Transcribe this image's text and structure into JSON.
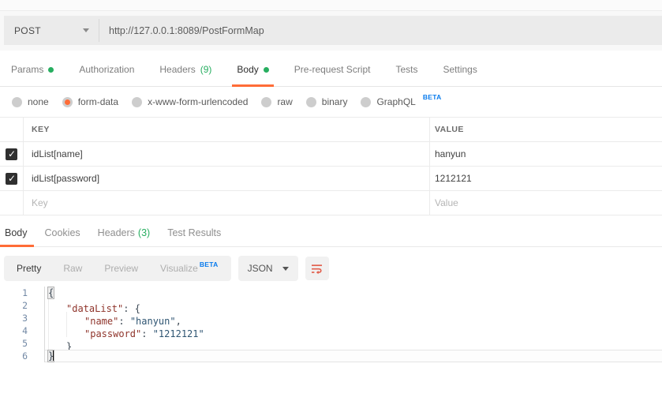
{
  "request": {
    "method": "POST",
    "url": "http://127.0.0.1:8089/PostFormMap",
    "tabs": [
      {
        "label": "Params",
        "has_dot": true,
        "active": false
      },
      {
        "label": "Authorization",
        "active": false
      },
      {
        "label": "Headers",
        "count": "(9)",
        "active": false
      },
      {
        "label": "Body",
        "has_dot": true,
        "active": true
      },
      {
        "label": "Pre-request Script",
        "active": false
      },
      {
        "label": "Tests",
        "active": false
      },
      {
        "label": "Settings",
        "active": false
      }
    ],
    "body_types": [
      {
        "label": "none",
        "selected": false
      },
      {
        "label": "form-data",
        "selected": true
      },
      {
        "label": "x-www-form-urlencoded",
        "selected": false
      },
      {
        "label": "raw",
        "selected": false
      },
      {
        "label": "binary",
        "selected": false
      },
      {
        "label": "GraphQL",
        "badge": "BETA",
        "selected": false
      }
    ],
    "table": {
      "headers": {
        "key": "KEY",
        "value": "VALUE"
      },
      "rows": [
        {
          "key": "idList[name]",
          "value": "hanyun",
          "checked": true
        },
        {
          "key": "idList[password]",
          "value": "1212121",
          "checked": true
        }
      ],
      "placeholder": {
        "key": "Key",
        "value": "Value"
      }
    }
  },
  "response": {
    "tabs": [
      {
        "label": "Body",
        "active": true
      },
      {
        "label": "Cookies",
        "active": false
      },
      {
        "label": "Headers",
        "count": "(3)",
        "active": false
      },
      {
        "label": "Test Results",
        "active": false
      }
    ],
    "views": [
      {
        "label": "Pretty",
        "active": true
      },
      {
        "label": "Raw",
        "active": false
      },
      {
        "label": "Preview",
        "active": false
      },
      {
        "label": "Visualize",
        "badge": "BETA",
        "active": false
      }
    ],
    "language": "JSON",
    "code": {
      "line_numbers": [
        "1",
        "2",
        "3",
        "4",
        "5",
        "6"
      ],
      "tokens": {
        "l1_open": "{",
        "l2_key": "\"dataList\"",
        "l2_sep": ": ",
        "l2_open": "{",
        "l3_key": "\"name\"",
        "l3_sep": ": ",
        "l3_val": "\"hanyun\"",
        "l3_comma": ",",
        "l4_key": "\"password\"",
        "l4_sep": ": ",
        "l4_val": "\"1212121\"",
        "l5_close": "}",
        "l6_close": "}"
      }
    }
  },
  "colors": {
    "accent_orange": "#ff6c37",
    "green": "#27ae60",
    "beta_blue": "#097bed"
  }
}
